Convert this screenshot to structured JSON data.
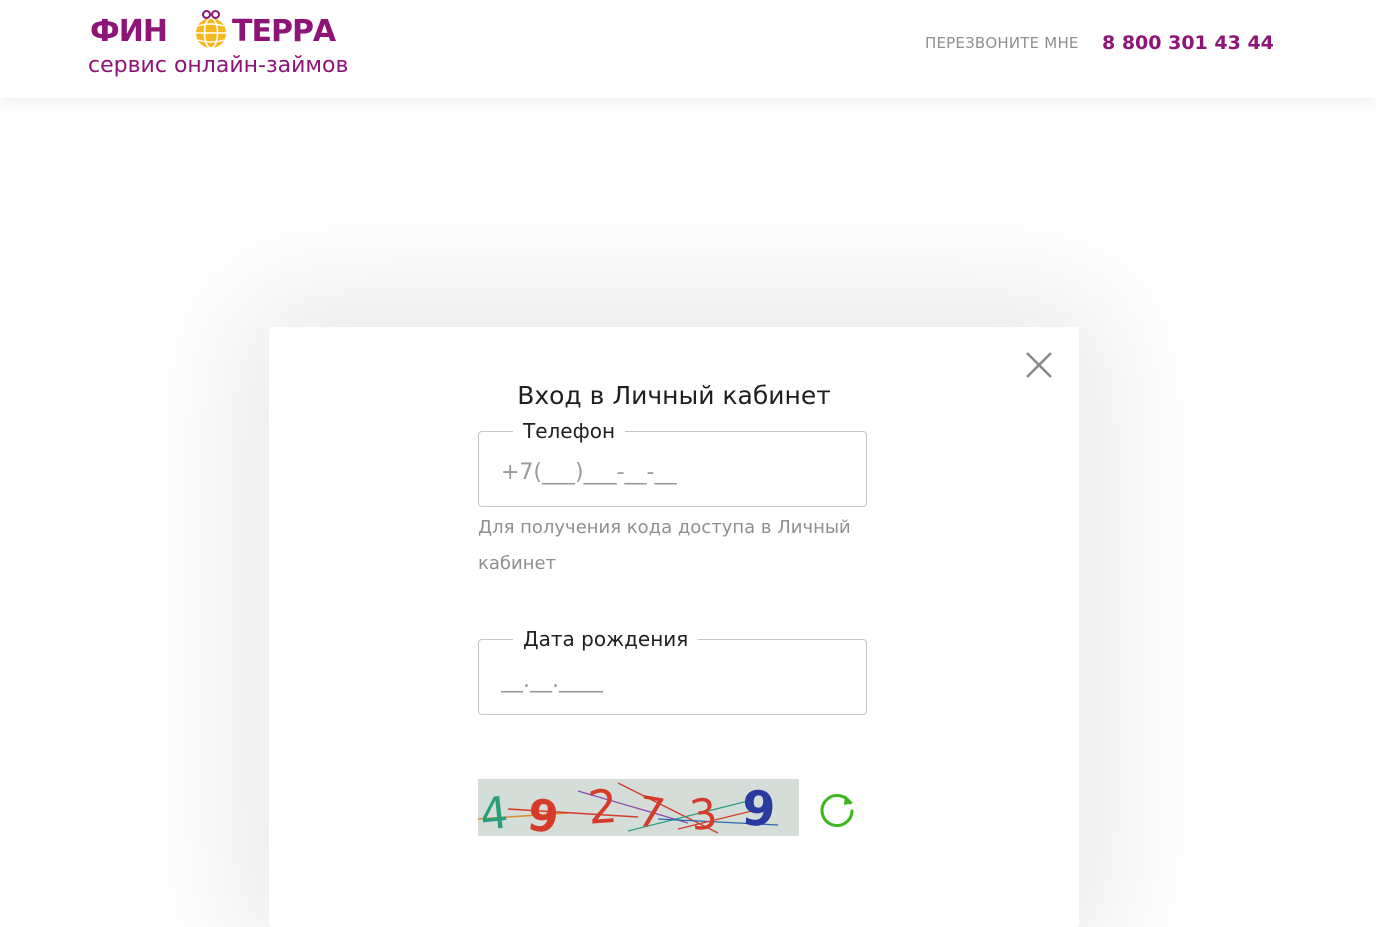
{
  "header": {
    "logo_left": "ФИН",
    "logo_right": "ТЕРРА",
    "tagline": "сервис онлайн-займов",
    "callback_label": "ПЕРЕЗВОНИТЕ МНЕ",
    "phone": "8 800 301 43 44",
    "brand_color": "#8e1478",
    "globe_color": "#f5b81e"
  },
  "login_modal": {
    "title": "Вход в Личный кабинет",
    "phone_field": {
      "label": "Телефон",
      "placeholder": "+7(___)___-__-__",
      "value": ""
    },
    "phone_hint": "Для получения кода доступа в Личный кабинет",
    "birthdate_field": {
      "label": "Дата рождения",
      "placeholder": "__.__.____",
      "value": ""
    },
    "captcha": {
      "digits": [
        "4",
        "9",
        "2",
        "7",
        "3",
        "9"
      ],
      "digit_colors": [
        "#2a9d7a",
        "#d63a2a",
        "#d63a2a",
        "#d63a2a",
        "#d63a2a",
        "#2b3a9e"
      ]
    },
    "close_icon": "close-icon",
    "refresh_icon": "refresh-icon",
    "refresh_color": "#3cb81e"
  }
}
